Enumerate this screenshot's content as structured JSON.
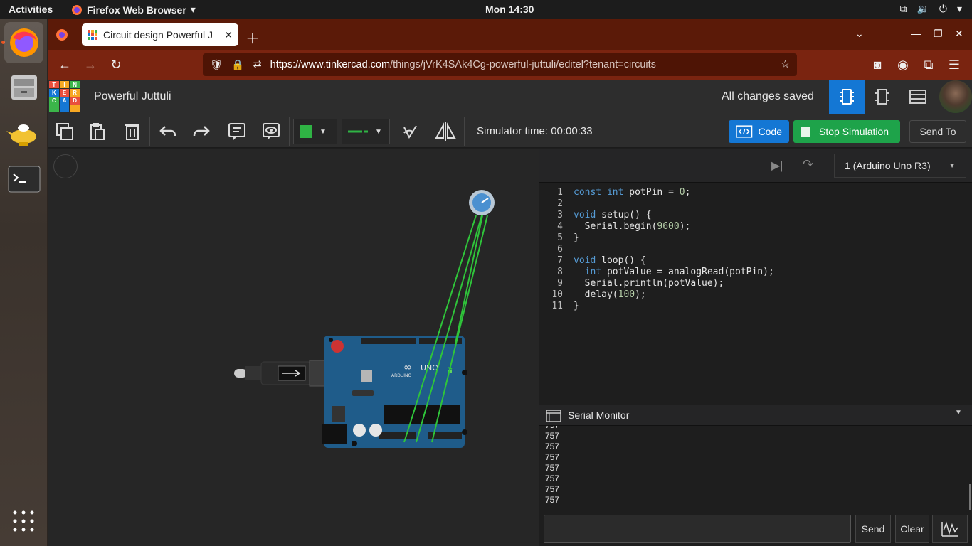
{
  "os": {
    "activities": "Activities",
    "app_name": "Firefox Web Browser",
    "clock": "Mon 14:30"
  },
  "browser": {
    "tab_title": "Circuit design Powerful J",
    "url_host": "https://www.tinkercad.com",
    "url_path": "/things/jVrK4SAk4Cg-powerful-juttuli/editel?tenant=circuits"
  },
  "tinkercad": {
    "logo_letters": [
      "T",
      "I",
      "N",
      "K",
      "E",
      "R",
      "C",
      "A",
      "D"
    ],
    "project_name": "Powerful Juttuli",
    "save_status": "All changes saved",
    "sim_time": "Simulator time: 00:00:33",
    "code_label": "Code",
    "stop_label": "Stop Simulation",
    "send_to_label": "Send To",
    "board_select": "1 (Arduino Uno R3)",
    "serial_monitor_label": "Serial Monitor",
    "send_label": "Send",
    "clear_label": "Clear",
    "wire_color": "#2fc53a",
    "accent": "#1477d4",
    "sim_color": "#1ea34a"
  },
  "code": {
    "line_numbers": [
      "1",
      "2",
      "3",
      "4",
      "5",
      "6",
      "7",
      "8",
      "9",
      "10",
      "11"
    ]
  },
  "serial_output": [
    "757",
    "757",
    "757",
    "757",
    "757",
    "757",
    "757",
    "757"
  ]
}
